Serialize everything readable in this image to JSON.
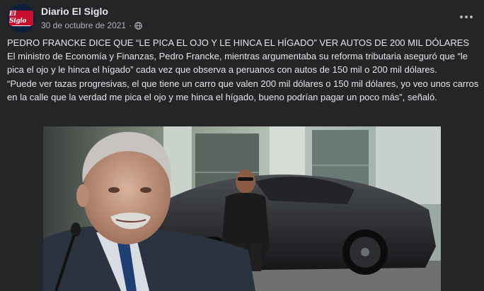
{
  "post": {
    "page_name": "Diario El Siglo",
    "date": "30 de octubre de 2021",
    "separator": "·",
    "avatar_text_1": "El Siglo",
    "icons": {
      "privacy": "globe-icon",
      "more": "more-options-icon"
    },
    "body": [
      "PEDRO FRANCKE DICE QUE “LE PICA EL OJO Y LE HINCA EL HÍGADO” VER AUTOS DE 200 MIL DÓLARES",
      "El ministro de Economía y Finanzas, Pedro Francke, mientras argumentaba su reforma tributaria aseguró que “le pica el ojo y le hinca el hígado” cada vez que observa a peruanos con autos de 150 mil o 200 mil dólares.",
      "“Puede ver tazas progresivas, el que tiene un carro que valen 200 mil dólares o 150 mil dólares, yo veo unos carros en la calle que la verdad me pica el ojo y me hinca el hígado, bueno podrían pagar un poco más”, señaló."
    ]
  },
  "colors": {
    "background": "#242526",
    "text_primary": "#e4e6eb",
    "text_secondary": "#b0b3b8",
    "avatar_brand": "#c8102e"
  }
}
